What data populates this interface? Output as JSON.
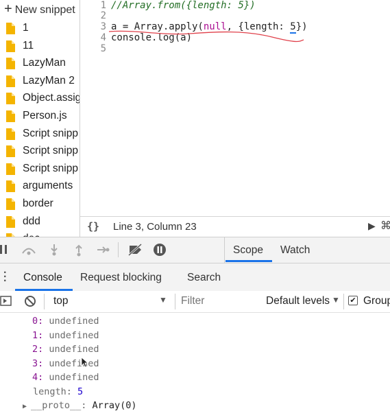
{
  "sidebar": {
    "new_snippet": "New snippet",
    "items": [
      "1",
      "11",
      "LazyMan",
      "LazyMan 2",
      "Object.assig",
      "Person.js",
      "Script snipp",
      "Script snipp",
      "Script snipp",
      "arguments",
      "border",
      "ddd",
      "dec"
    ]
  },
  "editor": {
    "line_numbers": [
      "1",
      "2",
      "3",
      "4",
      "5"
    ],
    "line1": "//Array.from({length: 5})",
    "line3_a": "a = Array.apply(",
    "line3_null": "null",
    "line3_b": ", {length: ",
    "line3_num": "5",
    "line3_c": "})",
    "line4": "console.log(a)"
  },
  "status": {
    "braces": "{}",
    "position": "Line 3, Column 23"
  },
  "debugger": {
    "tabs": [
      "Scope",
      "Watch"
    ]
  },
  "drawer": {
    "tabs": [
      "Console",
      "Request blocking",
      "Search"
    ]
  },
  "console_toolbar": {
    "context": "top",
    "filter_placeholder": "Filter",
    "levels": "Default levels",
    "group": "Group"
  },
  "output": {
    "entries": [
      {
        "key": "0",
        "value": "undefined"
      },
      {
        "key": "1",
        "value": "undefined"
      },
      {
        "key": "2",
        "value": "undefined"
      },
      {
        "key": "3",
        "value": "undefined"
      },
      {
        "key": "4",
        "value": "undefined"
      }
    ],
    "length_key": "length",
    "length_value": "5",
    "proto_key": "__proto__",
    "proto_value": "Array(0)"
  },
  "colors": {
    "accent": "#1a73e8",
    "file_icon": "#f4b400",
    "annotation": "#e0404a"
  }
}
